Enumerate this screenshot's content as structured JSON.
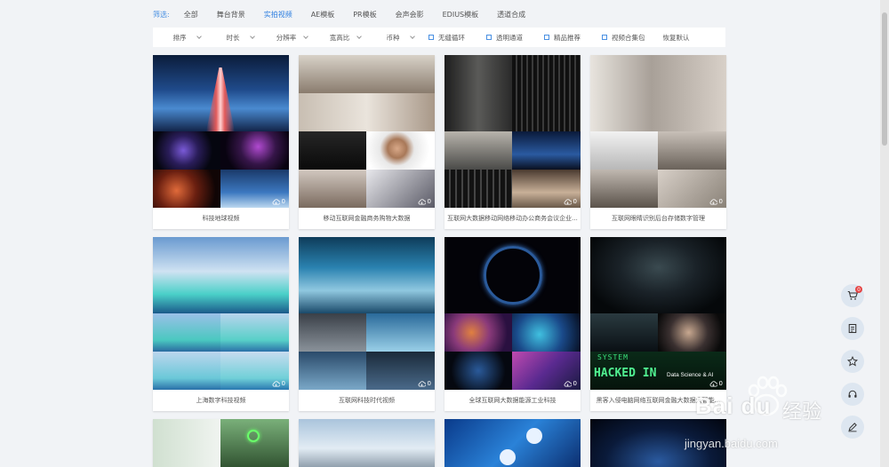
{
  "filter": {
    "label": "筛选:",
    "categories": [
      {
        "label": "全部",
        "active": false
      },
      {
        "label": "舞台背景",
        "active": false
      },
      {
        "label": "实拍视频",
        "active": true
      },
      {
        "label": "AE模板",
        "active": false
      },
      {
        "label": "PR模板",
        "active": false
      },
      {
        "label": "会声会影",
        "active": false
      },
      {
        "label": "EDIUS模板",
        "active": false
      },
      {
        "label": "透道合成",
        "active": false
      }
    ]
  },
  "sortbar": {
    "dropdowns": [
      "排序",
      "时长",
      "分辨率",
      "宽高比",
      "币种"
    ],
    "checkboxes": [
      "无缝循环",
      "透明通道",
      "精品推荐",
      "视频合集包"
    ],
    "reset": "恢复默认"
  },
  "cards": [
    {
      "title": "科技地球视频",
      "count": "0"
    },
    {
      "title": "移动互联网金融商务购物大数据",
      "count": "0"
    },
    {
      "title": "互联网大数据移动网络移动办公商务会议企业...",
      "count": "0"
    },
    {
      "title": "互联网眼睛识别后台存储数字管理",
      "count": "0"
    },
    {
      "title": "上海数字科技视频",
      "count": "0"
    },
    {
      "title": "互联网科技时代视频",
      "count": "0"
    },
    {
      "title": "全球互联网大数据能源工业科技",
      "count": "0"
    },
    {
      "title": "黑客入侵电脑网络互联网金融大数据大智能...",
      "count": "0"
    }
  ],
  "thumb_text": {
    "hacked": "HACKED IN",
    "system": "SYSTEM",
    "ds": "Data Science & AI"
  },
  "sidebar": {
    "cart_badge": "0"
  },
  "watermark": {
    "brand": "Bai du",
    "cn": "经验",
    "url": "jingyan.baidu.com"
  },
  "colors": {
    "accent": "#2f7fe0",
    "badge": "#e54545"
  },
  "icons": [
    "cart-icon",
    "list-icon",
    "star-icon",
    "headset-icon",
    "edit-icon",
    "cloud-download-icon"
  ]
}
